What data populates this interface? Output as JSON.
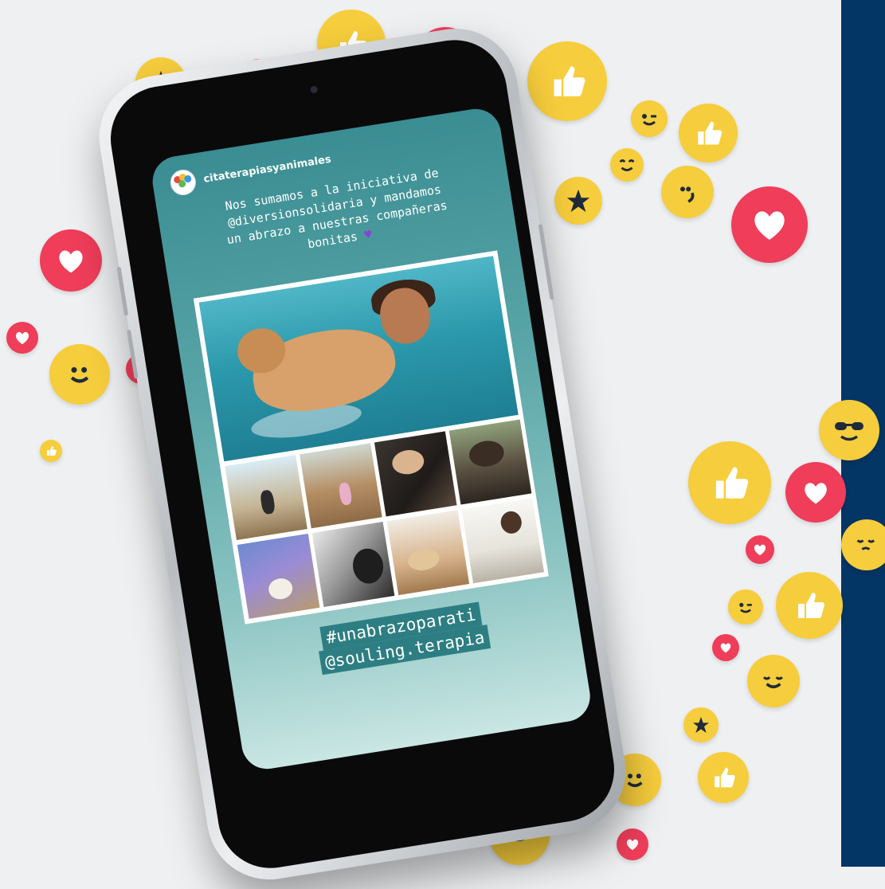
{
  "story": {
    "username": "citaterapiasyanimales",
    "avatar_mark": "CIUB",
    "caption_lines": [
      "Nos sumamos a la iniciativa de",
      "@diversionsolidaria y mandamos",
      "un abrazo a nuestras compañeras",
      "bonitas"
    ],
    "hashtag": "#unabrazoparati",
    "mention": "@souling.terapia"
  },
  "icons": {
    "caption_end": "purple-heart-icon",
    "tags_end": "rainbow-icon"
  },
  "colors": {
    "background": "#eef0f2",
    "navy_panel": "#033565",
    "heart_red": "#ef3d5a",
    "emoji_yellow": "#f6cd3c",
    "story_teal": "#3a8d92",
    "tag_bg": "#2d7e82"
  }
}
